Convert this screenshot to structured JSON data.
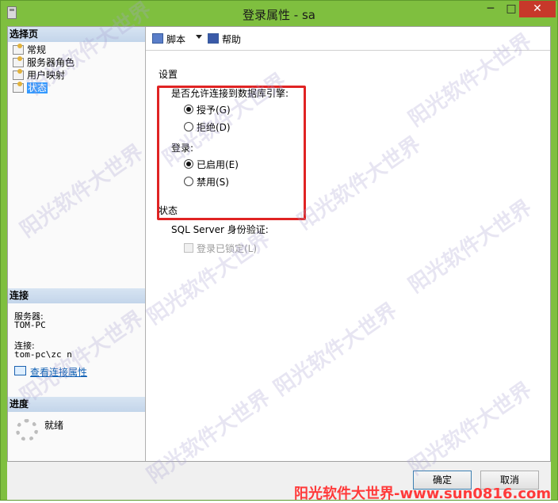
{
  "window": {
    "title": "登录属性 - sa",
    "minimize": "─",
    "maximize": "□",
    "close": "✕"
  },
  "left_pane": {
    "select_page_header": "选择页",
    "pages": [
      {
        "label": "常规"
      },
      {
        "label": "服务器角色"
      },
      {
        "label": "用户映射"
      },
      {
        "label": "状态",
        "selected": true
      }
    ],
    "connection_header": "连接",
    "server_label": "服务器:",
    "server_value": "TOM-PC",
    "connection_label": "连接:",
    "connection_value": "tom-pc\\zc     n",
    "view_connection_props": "查看连接属性",
    "progress_header": "进度",
    "progress_status": "就绪"
  },
  "toolbar": {
    "script_label": "脚本",
    "help_label": "帮助"
  },
  "content": {
    "settings_title": "设置",
    "permission_question": "是否允许连接到数据库引擎:",
    "grant_label": "授予(G)",
    "deny_label": "拒绝(D)",
    "login_title": "登录:",
    "enabled_label": "已启用(E)",
    "disabled_label": "禁用(S)",
    "status_title": "状态",
    "sql_auth_label": "SQL Server 身份验证:",
    "locked_label": "登录已锁定(L)",
    "selected_permission": "grant",
    "selected_login": "enabled"
  },
  "footer": {
    "ok_label": "确定",
    "cancel_label": "取消",
    "site_watermark": "阳光软件大世界-www.sun0816.com"
  },
  "watermark_text": "阳光软件大世界"
}
